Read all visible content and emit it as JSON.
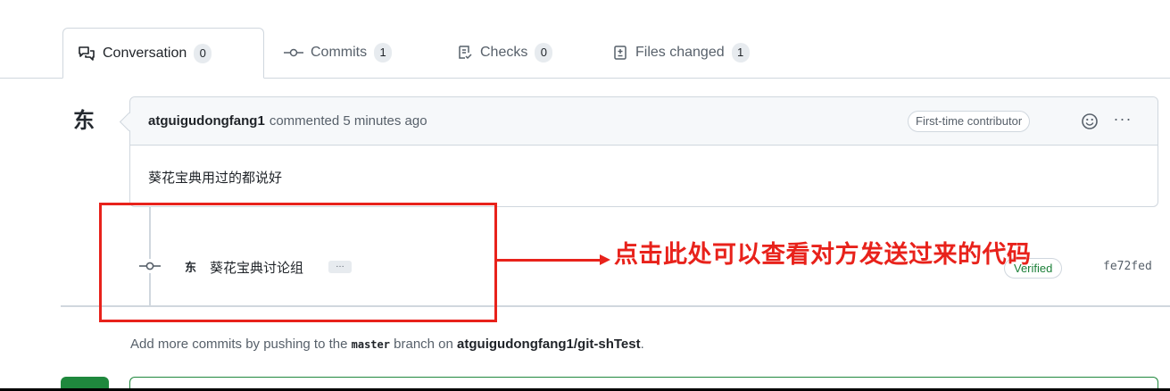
{
  "tabs": [
    {
      "label": "Conversation",
      "count": "0",
      "icon": "comment-discussion-icon"
    },
    {
      "label": "Commits",
      "count": "1",
      "icon": "git-commit-icon"
    },
    {
      "label": "Checks",
      "count": "0",
      "icon": "checklist-icon"
    },
    {
      "label": "Files changed",
      "count": "1",
      "icon": "file-diff-icon"
    }
  ],
  "comment": {
    "avatar_text": "东",
    "author": "atguigudongfang1",
    "meta": "commented 5 minutes ago",
    "badge": "First-time contributor",
    "more": "···",
    "body": "葵花宝典用过的都说好"
  },
  "commit": {
    "avatar_text": "东",
    "message": "葵花宝典讨论组",
    "ellipsis": "…",
    "verified": "Verified",
    "sha": "fe72fed"
  },
  "info": {
    "prefix": "Add more commits by pushing to the ",
    "branch": "master",
    "middle": " branch on ",
    "repo": "atguigudongfang1/git-shTest",
    "suffix": "."
  },
  "annotation": {
    "text": "点击此处可以查看对方发送过来的代码",
    "color": "#e8221b"
  },
  "colors": {
    "accent_green": "#1f883d",
    "verified_green": "#1a7f37",
    "border": "#d0d7de",
    "header_bg": "#f6f8fa"
  }
}
